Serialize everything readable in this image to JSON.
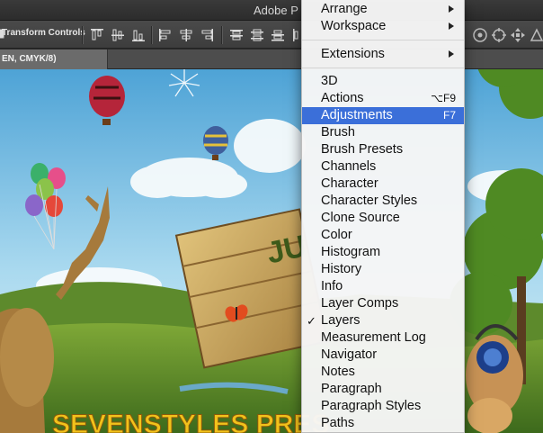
{
  "window": {
    "title_partial": "Adobe P"
  },
  "toolbar": {
    "transform_controls_label": "Transform Controls"
  },
  "document_tab": {
    "label": "EN, CMYK/8)"
  },
  "artwork": {
    "banner_text": "SEVENSTYLES PRES",
    "sign_text": "JU"
  },
  "menu": {
    "top_items": [
      {
        "label": "Arrange",
        "submenu": true
      },
      {
        "label": "Workspace",
        "submenu": true
      }
    ],
    "extensions": {
      "label": "Extensions",
      "submenu": true
    },
    "panels": [
      {
        "label": "3D"
      },
      {
        "label": "Actions",
        "shortcut": "⌥F9"
      },
      {
        "label": "Adjustments",
        "shortcut": "F7",
        "highlighted": true
      },
      {
        "label": "Brush"
      },
      {
        "label": "Brush Presets"
      },
      {
        "label": "Channels"
      },
      {
        "label": "Character"
      },
      {
        "label": "Character Styles"
      },
      {
        "label": "Clone Source"
      },
      {
        "label": "Color"
      },
      {
        "label": "Histogram"
      },
      {
        "label": "History"
      },
      {
        "label": "Info"
      },
      {
        "label": "Layer Comps"
      },
      {
        "label": "Layers",
        "checked": true
      },
      {
        "label": "Measurement Log"
      },
      {
        "label": "Navigator"
      },
      {
        "label": "Notes"
      },
      {
        "label": "Paragraph"
      },
      {
        "label": "Paragraph Styles"
      },
      {
        "label": "Paths"
      }
    ]
  },
  "colors": {
    "menu_highlight": "#3b6fd9",
    "toolbar_bg": "#434343",
    "banner_yellow": "#f2c21b"
  }
}
